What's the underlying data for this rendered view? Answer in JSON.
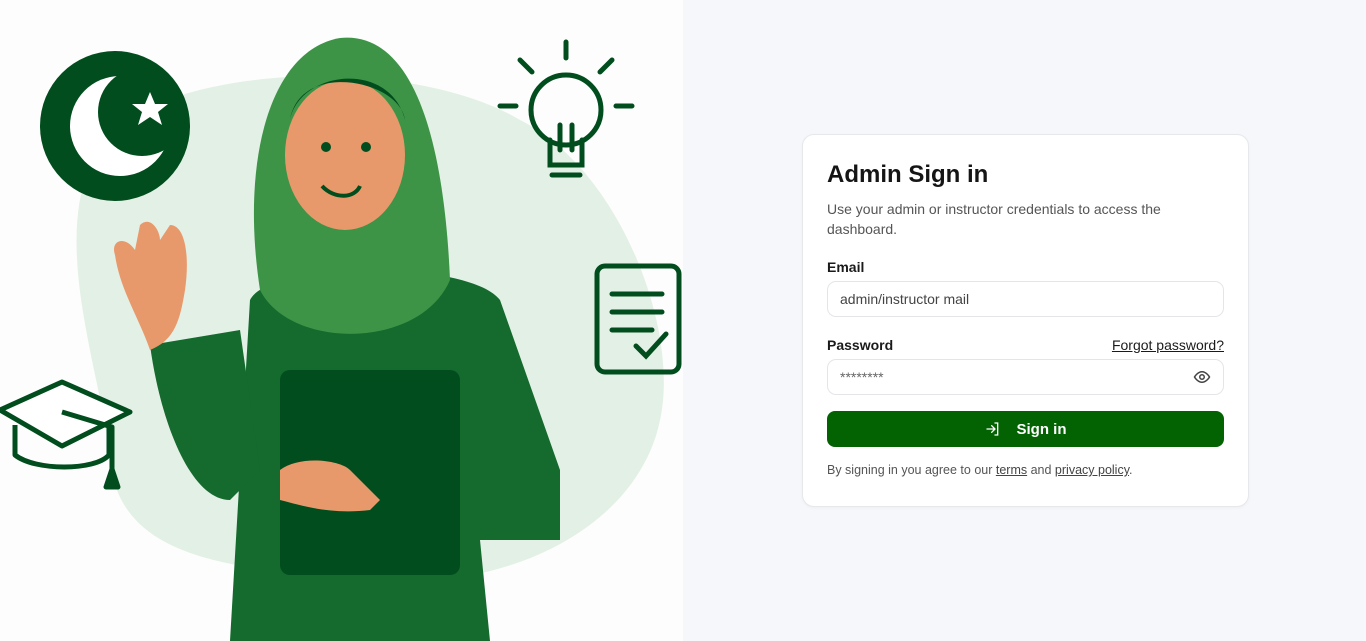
{
  "colors": {
    "primary": "#036303",
    "illustration_dark": "#014d1e",
    "illustration_mid": "#156a2e"
  },
  "illustration": {
    "icons": [
      "crescent-star-icon",
      "lightbulb-icon",
      "checklist-document-icon",
      "graduation-cap-icon"
    ]
  },
  "signin": {
    "title": "Admin Sign in",
    "subtitle": "Use your admin or instructor credentials to access the dashboard.",
    "email_label": "Email",
    "email_value": "admin/instructor mail",
    "password_label": "Password",
    "forgot_label": "Forgot password?",
    "password_placeholder": "********",
    "submit_label": "Sign in",
    "footer_prefix": "By signing in you agree to our ",
    "terms_label": "terms",
    "footer_and": " and ",
    "privacy_label": "privacy policy",
    "footer_suffix": "."
  }
}
